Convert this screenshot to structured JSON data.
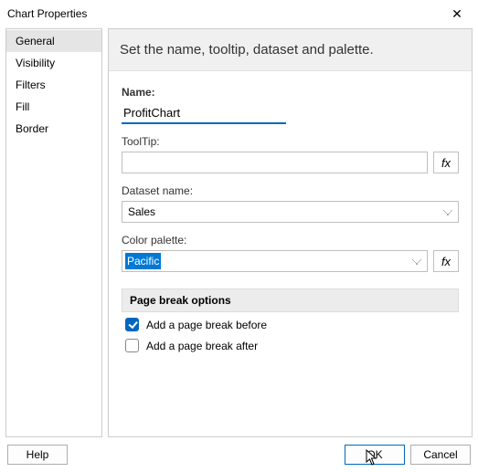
{
  "window": {
    "title": "Chart Properties"
  },
  "sidebar": {
    "items": [
      {
        "label": "General",
        "selected": true
      },
      {
        "label": "Visibility",
        "selected": false
      },
      {
        "label": "Filters",
        "selected": false
      },
      {
        "label": "Fill",
        "selected": false
      },
      {
        "label": "Border",
        "selected": false
      }
    ]
  },
  "main": {
    "instruction": "Set the name, tooltip, dataset and palette.",
    "name": {
      "label": "Name:",
      "value": "ProfitChart"
    },
    "tooltip": {
      "label": "ToolTip:",
      "value": ""
    },
    "dataset": {
      "label": "Dataset name:",
      "value": "Sales"
    },
    "palette": {
      "label": "Color palette:",
      "value": "Pacific"
    },
    "pageBreak": {
      "heading": "Page break options",
      "before": {
        "label": "Add a page break before",
        "checked": true
      },
      "after": {
        "label": "Add a page break after",
        "checked": false
      }
    }
  },
  "footer": {
    "help": "Help",
    "ok": "OK",
    "cancel": "Cancel"
  },
  "icons": {
    "fx": "fx",
    "close": "✕"
  }
}
